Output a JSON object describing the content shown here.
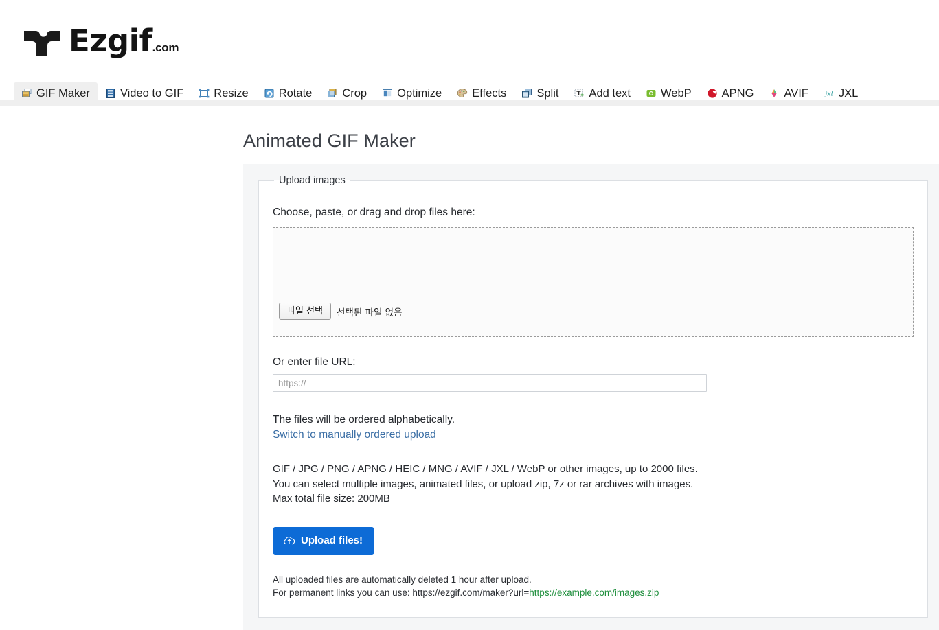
{
  "site": {
    "logo_text": "Ezgif",
    "logo_tld": ".com",
    "logo_icon": "ezgif-puzzle-logo"
  },
  "nav": {
    "tabs": [
      {
        "label": "GIF Maker",
        "icon": "gif-maker-icon",
        "active": true
      },
      {
        "label": "Video to GIF",
        "icon": "video-to-gif-icon",
        "active": false
      },
      {
        "label": "Resize",
        "icon": "resize-icon",
        "active": false
      },
      {
        "label": "Rotate",
        "icon": "rotate-icon",
        "active": false
      },
      {
        "label": "Crop",
        "icon": "crop-icon",
        "active": false
      },
      {
        "label": "Optimize",
        "icon": "optimize-icon",
        "active": false
      },
      {
        "label": "Effects",
        "icon": "effects-palette-icon",
        "active": false
      },
      {
        "label": "Split",
        "icon": "split-icon",
        "active": false
      },
      {
        "label": "Add text",
        "icon": "add-text-icon",
        "active": false
      },
      {
        "label": "WebP",
        "icon": "webp-icon",
        "active": false
      },
      {
        "label": "APNG",
        "icon": "apng-icon",
        "active": false
      },
      {
        "label": "AVIF",
        "icon": "avif-icon",
        "active": false
      },
      {
        "label": "JXL",
        "icon": "jxl-icon",
        "active": false
      }
    ]
  },
  "main": {
    "page_title": "Animated GIF Maker",
    "fieldset_legend": "Upload images",
    "choose_label": "Choose, paste, or drag and drop files here:",
    "file_button_label": "파일 선택",
    "file_status_text": "선택된 파일 없음",
    "url_label": "Or enter file URL:",
    "url_placeholder": "https://",
    "url_value": "",
    "order_note": "The files will be ordered alphabetically.",
    "order_link": "Switch to manually ordered upload",
    "formats_line1": "GIF / JPG / PNG / APNG / HEIC / MNG / AVIF / JXL / WebP or other images, up to 2000 files.",
    "formats_line2": "You can select multiple images, animated files, or upload zip, 7z or rar archives with images.",
    "formats_line3": "Max total file size: 200MB",
    "upload_button_label": "Upload files!",
    "upload_button_icon": "cloud-upload-icon",
    "footnote_line1": "All uploaded files are automatically deleted 1 hour after upload.",
    "footnote_line2_prefix": "For permanent links you can use: https://ezgif.com/maker?url=",
    "footnote_line2_url": "https://example.com/images.zip"
  },
  "colors": {
    "accent_blue": "#0d6bd6",
    "link_blue": "#3a6ea5",
    "green_url": "#1f8f3d",
    "panel_bg": "#f5f6f7",
    "tab_active_bg": "#efefef"
  }
}
